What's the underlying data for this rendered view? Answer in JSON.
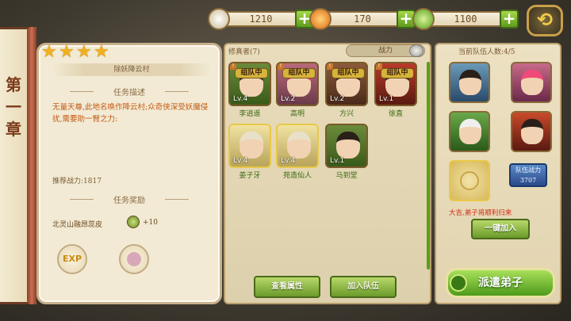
{
  "resources": [
    {
      "value": "1210",
      "color": "#e8d8b4"
    },
    {
      "value": "170",
      "color": "#f08a1a"
    },
    {
      "value": "1100",
      "color": "#8cc83a"
    }
  ],
  "chapter": {
    "label": "第一章"
  },
  "task": {
    "stars": 4,
    "title": "除妖降云村",
    "desc_header": "任务描述",
    "description": "无量天尊,此地名唤作降云村;众奇侠深受妖魔侵扰,需要助一臂之力:",
    "recommended_power": "推荐战力:1817",
    "reward_header": "任务奖励",
    "reward_text": "北灵山融昂蕊皮",
    "reward_qty": "+10",
    "reward_icons": [
      "EXP",
      "resource"
    ]
  },
  "disciples": {
    "label": "修真者(7)",
    "sort_label": "战力",
    "items": [
      {
        "name": "李逍遥",
        "lv": "Lv.4",
        "badge": "组队中",
        "gold": false
      },
      {
        "name": "高明",
        "lv": "Lv.2",
        "badge": "组队中",
        "gold": false
      },
      {
        "name": "方兴",
        "lv": "Lv.2",
        "badge": "组队中",
        "gold": false
      },
      {
        "name": "徐直",
        "lv": "Lv.1",
        "badge": "组队中",
        "gold": false
      },
      {
        "name": "姜子牙",
        "lv": "Lv.4",
        "badge": "",
        "gold": true
      },
      {
        "name": "苑造仙人",
        "lv": "Lv.4",
        "badge": "",
        "gold": true
      },
      {
        "name": "马到堂",
        "lv": "Lv.1",
        "badge": "",
        "gold": false
      }
    ],
    "view_button": "查看属性",
    "join_button": "加入队伍"
  },
  "team": {
    "count_label": "当前队伍人数:4/5",
    "power_label": "队伍战力",
    "power_value": "3707",
    "warning": "大吉,弟子将顺利归来",
    "one_click": "一键加入",
    "dispatch": "派遣弟子"
  }
}
